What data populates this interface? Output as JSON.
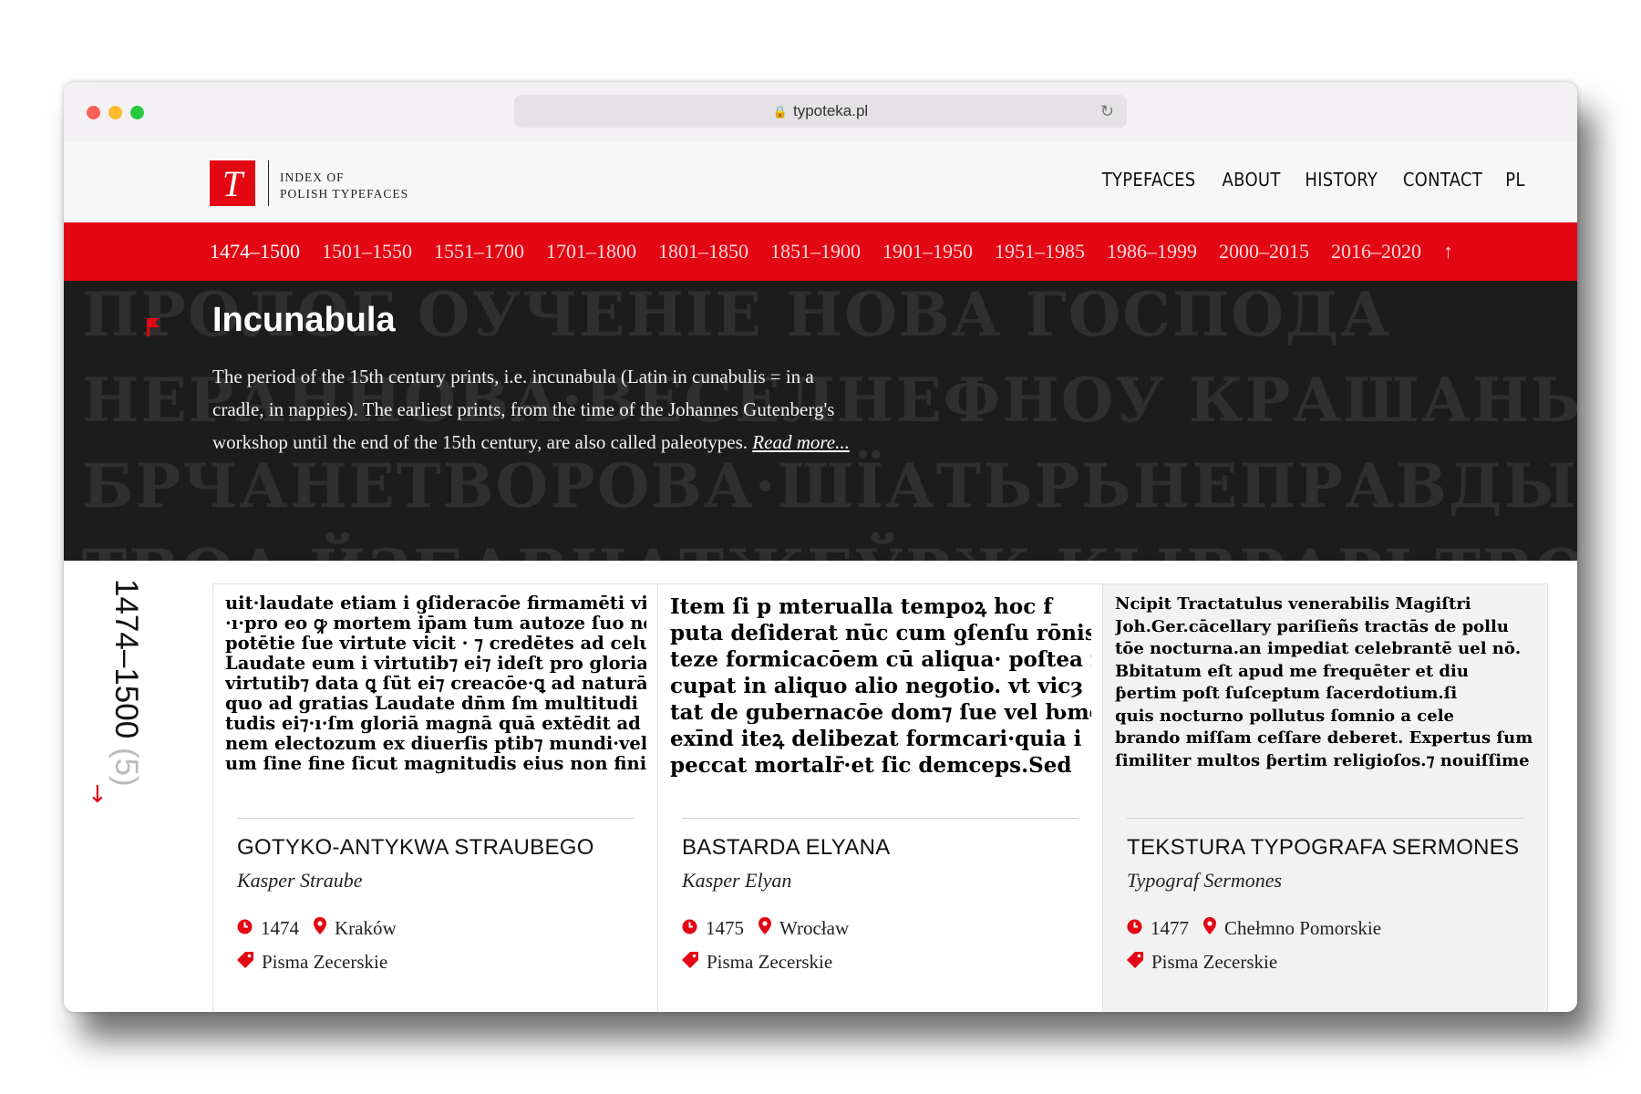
{
  "browser": {
    "url": "typoteka.pl"
  },
  "site": {
    "logo_letter": "T",
    "logo_line1": "INDEX OF",
    "logo_line2": "POLISH TYPEFACES",
    "nav": [
      "TYPEFACES",
      "ABOUT",
      "HISTORY",
      "CONTACT",
      "PL"
    ]
  },
  "periods": {
    "items": [
      "1474–1500",
      "1501–1550",
      "1551–1700",
      "1701–1800",
      "1801–1850",
      "1851–1900",
      "1901–1950",
      "1951–1985",
      "1986–1999",
      "2000–2015",
      "2016–2020"
    ],
    "active": "1474–1500",
    "up_arrow": "↑"
  },
  "hero": {
    "title": "Incunabula",
    "description": "The period of the 15th century prints, i.e. incunabula (Latin in cunabulis = in a cradle, in nappies). The earliest prints, from the time of the Johannes Gutenberg's workshop until the end of the 15th century, are also called paleotypes.",
    "read_more": "Read more...",
    "background_lines": [
      "ПРОЛОГ ОУЧЕНІЕ НОВА ГОСПОДА",
      "НЕРАННОВА·ВЕСЕЛНЕФНОУ КРАШАНЬСАОКЪСЕГО",
      "БРЧАНЕТВОРОВА·ШЇАТЬРЬНЕПРАВДЫ",
      "ТВОА·ЙЗБАВНАТЖЕЎРЖ КЫВРАРЬТВОНХЬ·ВЪ"
    ]
  },
  "section": {
    "range": "1474–1500",
    "count": "(5)",
    "down_arrow": "↓"
  },
  "cards": [
    {
      "title": "GOTYKO-ANTYKWA STRAUBEGO",
      "author": "Kasper Straube",
      "year": "1474",
      "place": "Kraków",
      "category": "Pisma Zecerskie",
      "specimen": [
        "uit·laudate etiam i ƍſideracōe firmamēti vic",
        "·ı·pro eo ꝙ mortem ip̄am tum autoze ſuo ne",
        "potētie ſue virtute vicit · ⁊ credētes ad celum",
        "Laudate eum i virtutib⁊ ei⁊ ideſt pro gloria",
        "virtutib⁊ data ꝗ ſūt ei⁊ creacōe·ꝗ ad naturā",
        "quo ad gratias Laudate dn̄m ſm multitudi",
        "tudis ei⁊·ı·ſm gloriā magnā quā extēdit ad",
        "nem electozum ex diuerſis ptib⁊ mundi·vel",
        "um ſine fine ſicut magnitudis eius non fini"
      ]
    },
    {
      "title": "BASTARDA ELYANA",
      "author": "Kasper Elyan",
      "year": "1475",
      "place": "Wrocław",
      "category": "Pisma Zecerskie",
      "specimen": [
        "Item ſi p mterualla tempoꝝ hoc f",
        "puta deſiderat nūc cum ƍſenſu rōnis",
        "teze formicacōem cū aliqua· poſtea ſ",
        "cupat in aliquo alio negotio. vt vicȝ",
        "tat de gubernacōe dom⁊ ſue vel ƕmō",
        "exīnd iteꝝ delibezat formcari·quia i",
        "peccat mortalr̄·et ſic demceps.Sed"
      ]
    },
    {
      "title": "TEKSTURA TYPOGRAFA SERMONES",
      "author": "Typograf Sermones",
      "year": "1477",
      "place": "Chełmno Pomorskie",
      "category": "Pisma Zecerskie",
      "specimen": [
        "Ncipit Tractatulus venerabilis Magiſtri",
        "Joh.Ger.cācellary pariſieñs tractās de pollu",
        "tōe nocturna.an impediat celebrantē uel nō.",
        "Bbitatum eſt apud me frequēter et diu",
        "ƥertim poſt ſuſceptum ſacerdotium.ſi",
        "quis nocturno pollutus ſomnio a cele",
        "brando miſſam ceſſare deberet. Expertus ſum",
        "ſimiliter multos ƥertim religioſos.⁊ nouiſſime"
      ]
    }
  ],
  "colors": {
    "brand_red": "#e30613",
    "hero_bg": "#1c1c1c"
  }
}
